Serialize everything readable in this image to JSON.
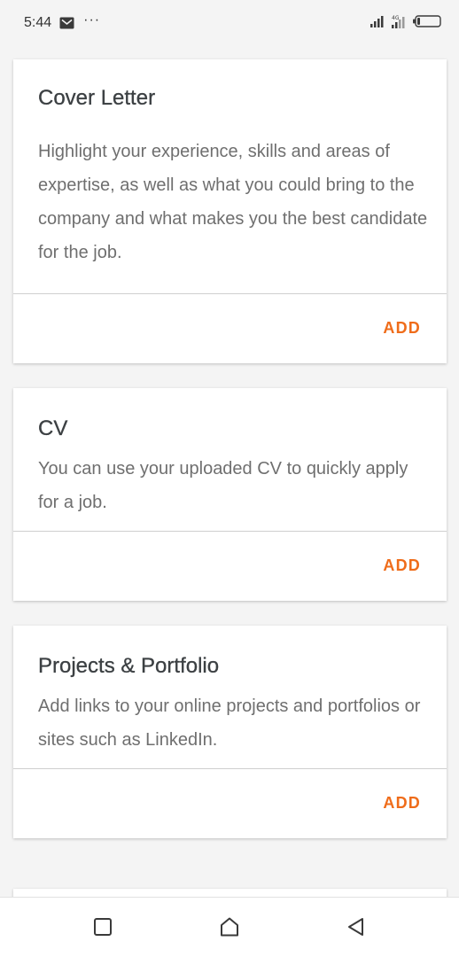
{
  "status_bar": {
    "time": "5:44",
    "icons": [
      "mail-icon",
      "more-dots-icon",
      "signal-icon",
      "signal-icon",
      "battery-icon"
    ],
    "more_indicator": "···"
  },
  "cards": [
    {
      "title": "Cover Letter",
      "description": "Highlight your experience, skills and areas of expertise, as well as what you could bring to the company and what makes you the best candidate for the job.",
      "action": "ADD"
    },
    {
      "title": "CV",
      "description": "You can use your uploaded CV to quickly apply for a job.",
      "action": "ADD"
    },
    {
      "title": "Projects & Portfolio",
      "description": "Add links to your online projects and portfolios or sites such as LinkedIn.",
      "action": "ADD"
    }
  ],
  "nav_bar": {
    "icons": [
      "recents-square-icon",
      "home-icon",
      "back-triangle-icon"
    ]
  },
  "colors": {
    "accent": "#ef6c1a",
    "title_text": "#3c4043",
    "body_text": "#6f6f6f",
    "background": "#f4f4f4"
  }
}
